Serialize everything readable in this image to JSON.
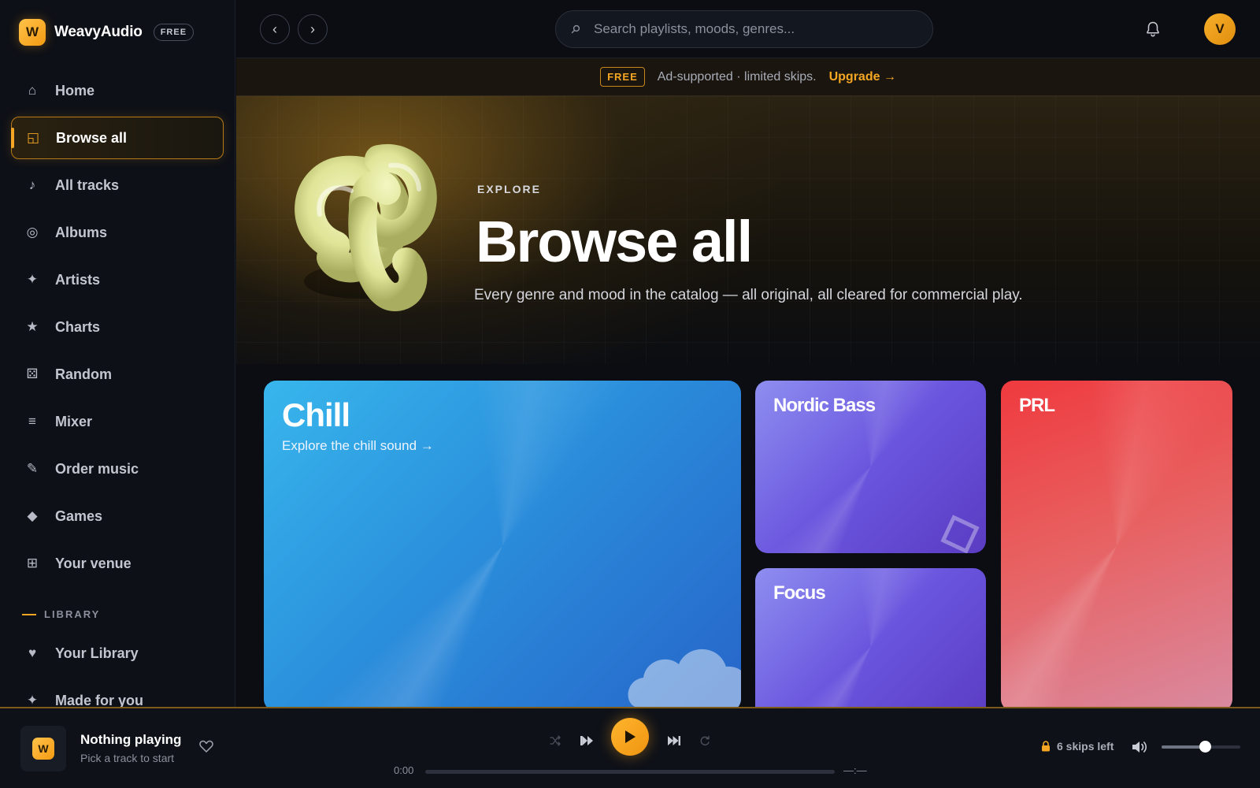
{
  "brand": {
    "logo_letter": "W",
    "name": "WeavyAudio",
    "badge": "FREE",
    "accent": "#f5a623"
  },
  "sidebar": {
    "items": [
      {
        "label": "Home",
        "icon": "home-icon",
        "glyph": "⌂"
      },
      {
        "label": "Browse all",
        "icon": "browse-icon",
        "glyph": "◱",
        "active": true
      },
      {
        "label": "All tracks",
        "icon": "music-note-icon",
        "glyph": "♪"
      },
      {
        "label": "Albums",
        "icon": "disc-icon",
        "glyph": "◎"
      },
      {
        "label": "Artists",
        "icon": "sparkle-icon",
        "glyph": "✦"
      },
      {
        "label": "Charts",
        "icon": "star-icon",
        "glyph": "★"
      },
      {
        "label": "Random",
        "icon": "dice-icon",
        "glyph": "⚄"
      },
      {
        "label": "Mixer",
        "icon": "sliders-icon",
        "glyph": "≡"
      },
      {
        "label": "Order music",
        "icon": "pen-icon",
        "glyph": "✎"
      },
      {
        "label": "Games",
        "icon": "diamond-icon",
        "glyph": "◆"
      },
      {
        "label": "Your venue",
        "icon": "grid-icon",
        "glyph": "⊞"
      }
    ],
    "library_heading": "LIBRARY",
    "library_items": [
      {
        "label": "Your Library",
        "icon": "heart-icon",
        "glyph": "♥"
      },
      {
        "label": "Made for you",
        "icon": "sparkle-icon",
        "glyph": "✦"
      }
    ]
  },
  "topbar": {
    "back_glyph": "‹",
    "forward_glyph": "›",
    "search_placeholder": "Search playlists, moods, genres...",
    "search_value": "",
    "avatar_letter": "V"
  },
  "ad_banner": {
    "badge": "FREE",
    "text": "Ad-supported · limited skips.",
    "link": "Upgrade →"
  },
  "hero": {
    "eyebrow": "EXPLORE",
    "title": "Browse all",
    "subtitle": "Every genre and mood in the catalog — all original, all cleared for commercial play."
  },
  "cards": [
    {
      "title": "Chill",
      "subtitle": "Explore the chill sound →"
    },
    {
      "title": "Nordic Bass"
    },
    {
      "title": "Focus"
    },
    {
      "title": "PRL"
    }
  ],
  "player": {
    "title": "Nothing playing",
    "subtitle": "Pick a track to start",
    "time_elapsed": "0:00",
    "time_total": "—:—",
    "progress": 0,
    "skips_left": "6 skips left",
    "volume": 0.55
  }
}
